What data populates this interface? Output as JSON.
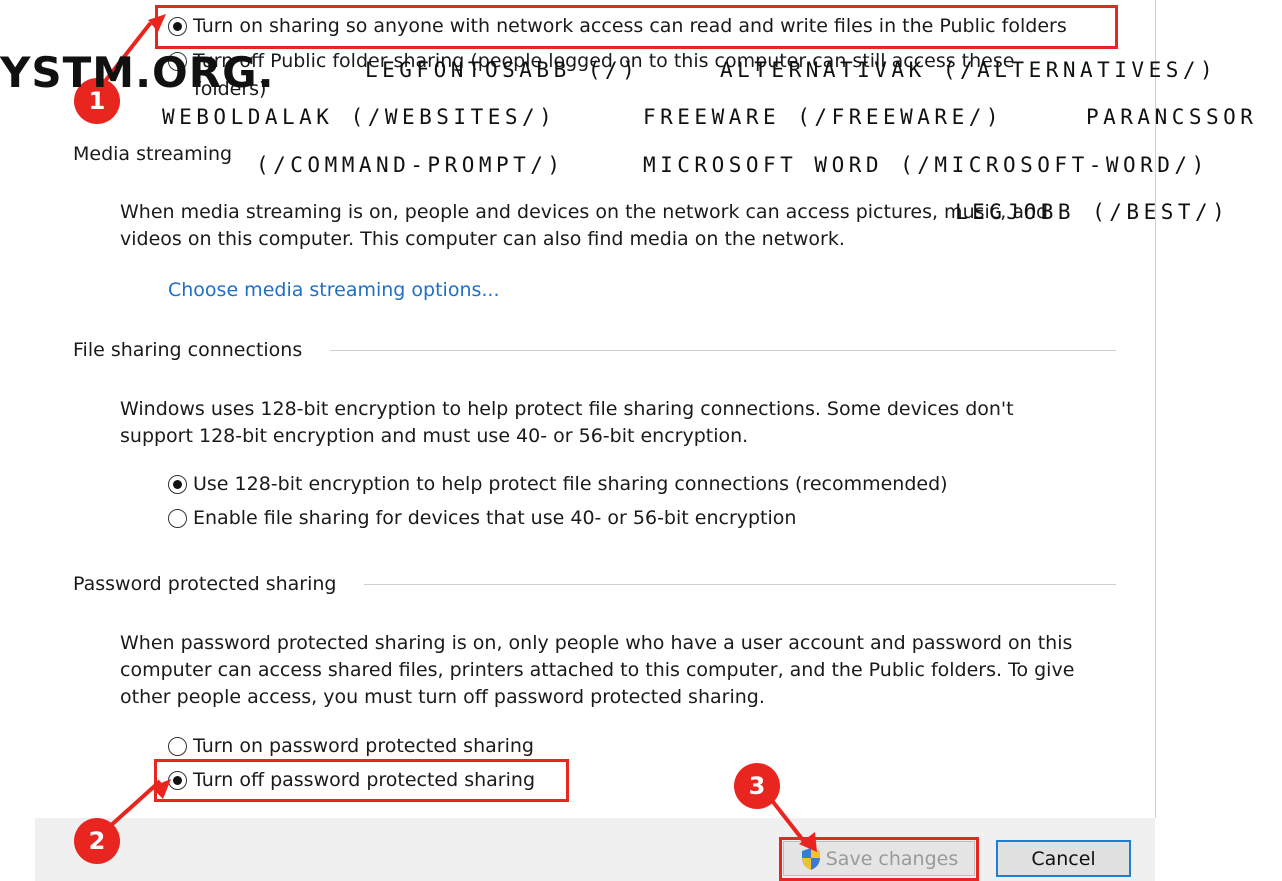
{
  "public_folder": {
    "option_on": "Turn on sharing so anyone with network access can read and write files in the Public folders",
    "option_off_line1": "Turn off Public folder sharing (people logged on to this computer can still access these",
    "option_off_line2": "folders)"
  },
  "media_streaming": {
    "heading": "Media streaming",
    "desc_line1": "When media streaming is on, people and devices on the network can access pictures, music, and",
    "desc_line2": "videos on this computer. This computer can also find media on the network.",
    "link": "Choose media streaming options..."
  },
  "file_sharing": {
    "heading": "File sharing connections",
    "desc_line1": "Windows uses 128-bit encryption to help protect file sharing connections. Some devices don't",
    "desc_line2": "support 128-bit encryption and must use 40- or 56-bit encryption.",
    "option_128": "Use 128-bit encryption to help protect file sharing connections (recommended)",
    "option_40_56": "Enable file sharing for devices that use 40- or 56-bit encryption"
  },
  "password_sharing": {
    "heading": "Password protected sharing",
    "desc_line1": "When password protected sharing is on, only people who have a user account and password on this",
    "desc_line2": "computer can access shared files, printers attached to this computer, and the Public folders. To give",
    "desc_line3": "other people access, you must turn off password protected sharing.",
    "option_on": "Turn on password protected sharing",
    "option_off": "Turn off password protected sharing"
  },
  "buttons": {
    "save": "Save changes",
    "cancel": "Cancel"
  },
  "annotations": {
    "step1": "1",
    "step2": "2",
    "step3": "3"
  },
  "watermark": {
    "logo": "YSTM.ORG.",
    "nav_1": "LEGFONTOSABB (/)",
    "nav_2": "ALTERNATIVAK (/ALTERNATIVES/)",
    "nav_3": "WEBOLDALAK (/WEBSITES/)",
    "nav_4": "FREEWARE (/FREEWARE/)",
    "nav_5": "PARANCSSOR",
    "nav_6": "(/COMMAND-PROMPT/)",
    "nav_7": "MICROSOFT WORD (/MICROSOFT-WORD/)",
    "nav_8": "LEGJOBB (/BEST/)"
  },
  "colors": {
    "accent_red": "#e8251f",
    "link_blue": "#1e6fc6",
    "cancel_border": "#1e7fd6"
  }
}
